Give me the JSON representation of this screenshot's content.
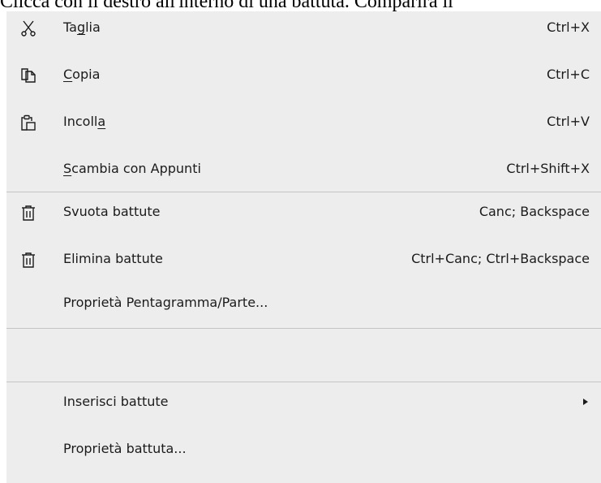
{
  "document": {
    "partial_text": "Clicca con il destro all'interno di una battuta. Comparirà il"
  },
  "menu": {
    "items": [
      {
        "icon": "scissors-icon",
        "label_pre": "Ta",
        "label_mnemonic": "g",
        "label_post": "lia",
        "shortcut": "Ctrl+X"
      },
      {
        "icon": "copy-icon",
        "label_pre": "",
        "label_mnemonic": "C",
        "label_post": "opia",
        "shortcut": "Ctrl+C"
      },
      {
        "icon": "paste-icon",
        "label_pre": "Incoll",
        "label_mnemonic": "a",
        "label_post": "",
        "shortcut": "Ctrl+V"
      },
      {
        "icon": "",
        "label_pre": "",
        "label_mnemonic": "S",
        "label_post": "cambia con Appunti",
        "shortcut": "Ctrl+Shift+X"
      },
      {
        "icon": "trash-icon",
        "label": "Svuota battute",
        "shortcut": "Canc; Backspace"
      },
      {
        "icon": "trash-icon",
        "label": "Elimina battute",
        "shortcut": "Ctrl+Canc; Ctrl+Backspace"
      },
      {
        "icon": "",
        "label": "Proprietà Pentagramma/Parte..."
      },
      {
        "icon": "",
        "label": "Inserisci battute",
        "submenu": true
      },
      {
        "icon": "",
        "label": "Proprietà battuta..."
      }
    ]
  },
  "colors": {
    "menu_background": "#ededed",
    "separator": "#c4c4c4",
    "text": "#1b1b1b"
  }
}
